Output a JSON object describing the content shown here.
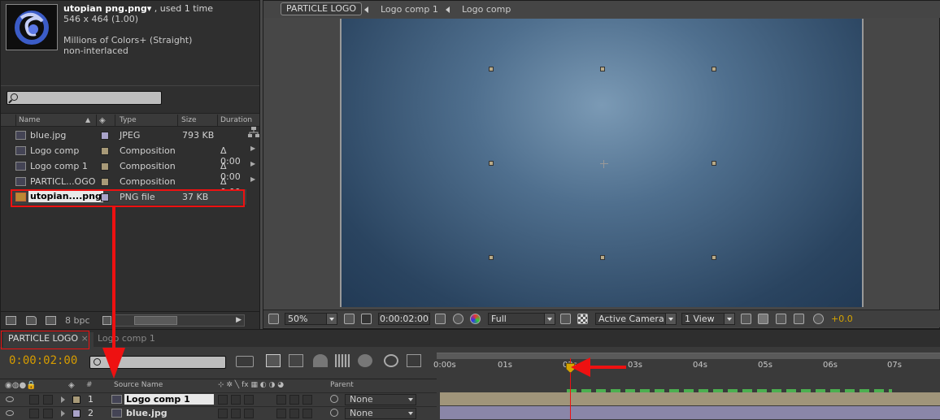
{
  "project": {
    "file_name": "utopian png.png",
    "used": ", used 1 time",
    "dimensions": "546 x 464 (1.00)",
    "colors": "Millions of Colors+ (Straight)",
    "interlace": "non-interlaced",
    "columns": {
      "name": "Name",
      "type": "Type",
      "size": "Size",
      "duration": "Duration"
    },
    "items": [
      {
        "name": "blue.jpg",
        "type": "JPEG",
        "size": "793 KB",
        "duration": "",
        "label_color": "#a9a3c9"
      },
      {
        "name": "Logo comp",
        "type": "Composition",
        "size": "",
        "duration": "Δ 0:00",
        "label_color": "#a89a78"
      },
      {
        "name": "Logo comp 1",
        "type": "Composition",
        "size": "",
        "duration": "Δ 0:00",
        "label_color": "#a89a78"
      },
      {
        "name": "PARTICL...OGO",
        "type": "Composition",
        "size": "",
        "duration": "Δ 0:00",
        "label_color": "#a89a78"
      },
      {
        "name": "utopian....png",
        "type": "PNG file",
        "size": "37 KB",
        "duration": "",
        "label_color": "#a9a3c9"
      }
    ],
    "bpc": "8 bpc"
  },
  "viewer": {
    "breadcrumbs": [
      "PARTICLE LOGO",
      "Logo comp 1",
      "Logo comp"
    ],
    "zoom": "50%",
    "timecode": "0:00:02:00",
    "resolution": "Full",
    "camera": "Active Camera",
    "views": "1 View",
    "exposure": "+0.0",
    "canvas_color": "#4f6f8e"
  },
  "timeline": {
    "tabs": [
      "PARTICLE LOGO",
      "Logo comp 1"
    ],
    "current_time": "0:00:02:00",
    "columns": {
      "num": "#",
      "source_name": "Source Name",
      "parent": "Parent"
    },
    "ticks": [
      "0:00s",
      "01s",
      "02s",
      "03s",
      "04s",
      "05s",
      "06s",
      "07s"
    ],
    "layers": [
      {
        "num": "1",
        "name": "Logo comp 1",
        "parent": "None",
        "label_color": "#a89a78"
      },
      {
        "num": "2",
        "name": "blue.jpg",
        "parent": "None",
        "label_color": "#a9a3c9"
      }
    ]
  },
  "colors": {
    "accent_time": "#d69c00",
    "annotation_red": "#e11111"
  }
}
